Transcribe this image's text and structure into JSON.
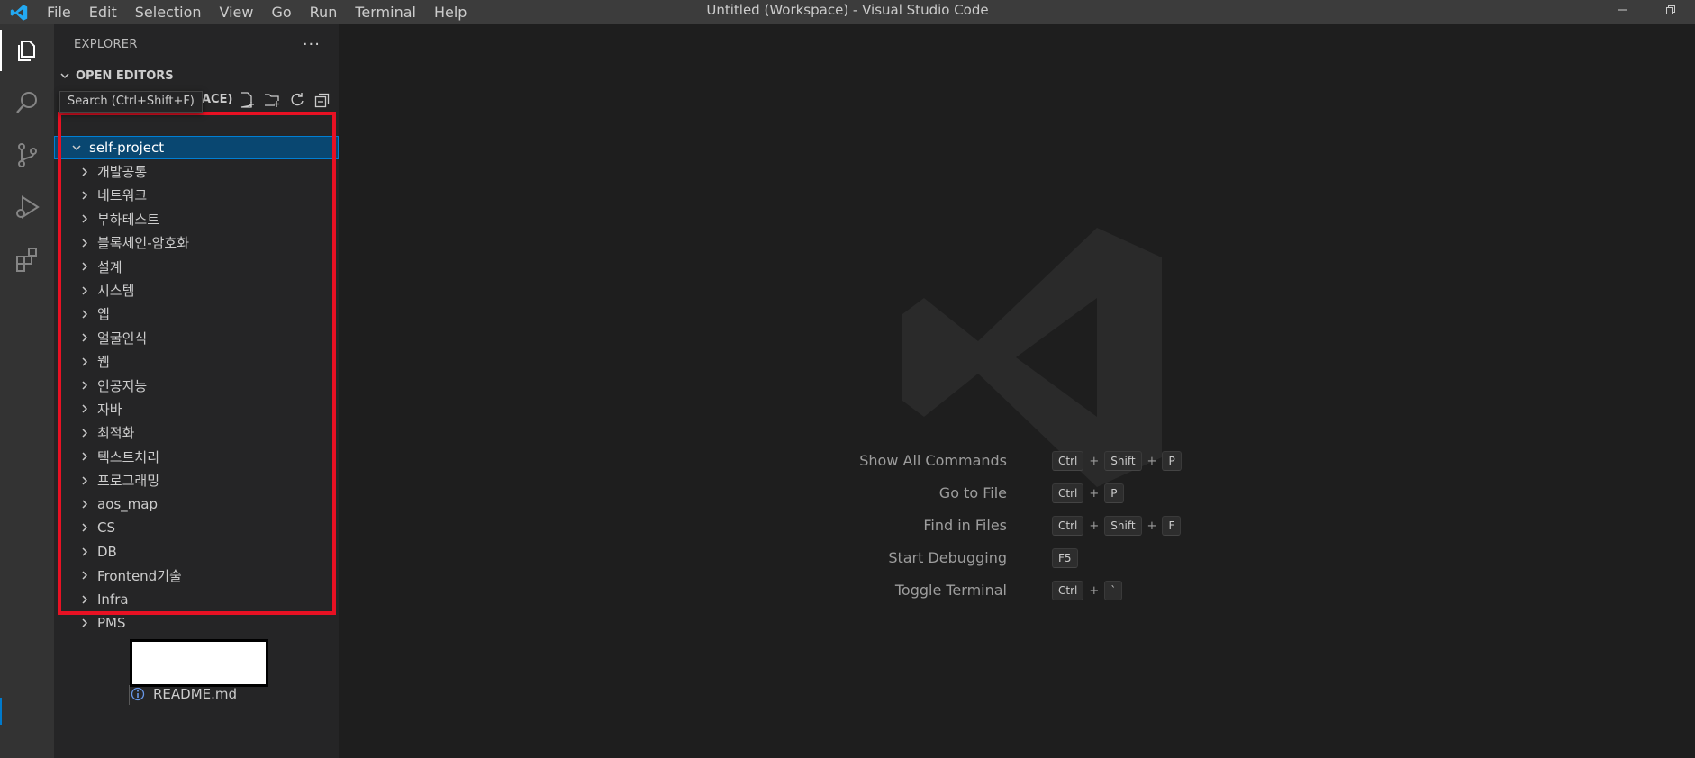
{
  "titlebar": {
    "menu": [
      "File",
      "Edit",
      "Selection",
      "View",
      "Go",
      "Run",
      "Terminal",
      "Help"
    ],
    "window_title": "Untitled (Workspace) - Visual Studio Code",
    "accent_color": "#23a9f2"
  },
  "activitybar": {
    "items": [
      {
        "icon": "files-icon",
        "active": true
      },
      {
        "icon": "search-icon",
        "active": false
      },
      {
        "icon": "source-control-icon",
        "active": false
      },
      {
        "icon": "run-debug-icon",
        "active": false
      },
      {
        "icon": "extensions-icon",
        "active": false
      }
    ]
  },
  "sidebar": {
    "title": "EXPLORER",
    "more": "···",
    "open_editors": "OPEN EDITORS",
    "workspace_title_fragment": "ACE)",
    "tooltip": "Search (Ctrl+Shift+F)",
    "root_folder": "self-project",
    "folders": [
      "개발공통",
      "네트워크",
      "부하테스트",
      "블록체인-암호화",
      "설계",
      "시스템",
      "앱",
      "얼굴인식",
      "웹",
      "인공지능",
      "자바",
      "최적화",
      "텍스트처리",
      "프로그래밍",
      "aos_map",
      "CS",
      "DB",
      "Frontend기술",
      "Infra",
      "PMS"
    ],
    "readme": "README.md"
  },
  "editor": {
    "shortcuts": [
      {
        "label": "Show All Commands",
        "keys": [
          "Ctrl",
          "Shift",
          "P"
        ]
      },
      {
        "label": "Go to File",
        "keys": [
          "Ctrl",
          "P"
        ]
      },
      {
        "label": "Find in Files",
        "keys": [
          "Ctrl",
          "Shift",
          "F"
        ]
      },
      {
        "label": "Start Debugging",
        "keys": [
          "F5"
        ]
      },
      {
        "label": "Toggle Terminal",
        "keys": [
          "Ctrl",
          "`"
        ]
      }
    ]
  },
  "colors": {
    "selection": "#094771",
    "highlight_box": "#e81123"
  }
}
